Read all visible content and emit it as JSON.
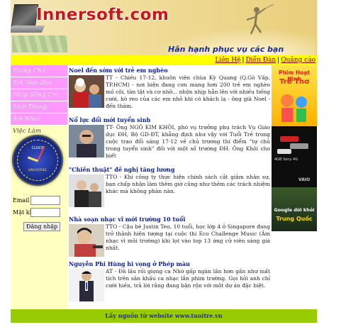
{
  "banner": {
    "logo": "Innersoft.com",
    "slogan": "Hân hạnh phục vụ các bạn"
  },
  "toplinks": [
    "Liên Hệ",
    "Diễn Đàn",
    "Quảng cáo"
  ],
  "sidebar": {
    "menu": [
      "Trang Chủ",
      "Tin Giáo Dục",
      "Nhịp Sống Trẻ",
      "Thời Trang",
      "Âm Nhạc",
      "Việc Làm"
    ],
    "clock_top": "CLOCK",
    "clock_bottom": "UNIVERSE"
  },
  "login": {
    "email_label": "Email",
    "password_label": "Mật khẩu",
    "submit_label": "Đăng nhập"
  },
  "articles": [
    {
      "title": "Noel đến sớm với trẻ em nghèo",
      "body": "TT - Chiều 17-12, khuôn viên chùa Kỳ Quang (Q.Gò Vấp, TP.HCM) - nơi hiện đang cưu mang hơn 200 trẻ em nghèo mồ côi, tàn tật và cơ nhỡ... nhộn nhịp hẳn lên với nhiều tiếng cười, hò reo của các em nhỏ khi có khách lạ - ông già Noel - đến thăm."
    },
    {
      "title": "Nổ lực đổi mới tuyển sinh",
      "body": "TT- Ông NGÔ KIM KHÔI, phó vụ trưởng phụ trách Vụ Giáo dục ĐH, Bộ GD-ĐT, khẳng định như vậy với Tuổi Trẻ trong cuộc trao đổi sáng 17-12 về chủ trương thí điểm \"tự chủ trong tuyển sinh\" đối với một số trường ĐH. Ông Khôi cho biết"
    },
    {
      "title": "\"Chiến thuật\" đề nghị tăng lương",
      "body": "TTO - Khi công ty thực hiện chính sách cắt giảm nhân sự, bạn chấp nhận làm thêm giờ cũng như thêm các trách nhiệm khác mà không phàn nàn."
    },
    {
      "title": "Nhà soạn nhạc vĩ mới trường 10 tuổi",
      "body": "TTO - Cậu bé Justin Teo, 10 tuổi, học lớp 4 ở Singapore đang trở thành hiện tượng tại cuộc thi Eco Challenge Music (Âm nhạc vì môi trường) khi lọt vào top 13 ứng cử viên sáng giá nhất."
    },
    {
      "title": "Nguyễn Phi Hùng hi vọng ở Phép màu",
      "body": "AT - Đã lâu rồi giọng ca Nhớ gấp ngàn lần hơn gần như mất tích trên sân khấu ca nhạc lẫn phim trường. Gọi hỏi anh chỉ cười hiền, trả lời rằng đang bận rộn với một dự án đặc biệt."
    }
  ],
  "ads": {
    "ad1_line1": "Phim Hoạt Hình",
    "ad1_line2": "Trẻ Thơ",
    "ad2_text": "4GB Sony 4G",
    "ad2_brand": "VAIO",
    "ad3_line1": "Google dời khỏi",
    "ad3_line2": "Trung Quốc"
  },
  "footer": {
    "text": "Lấy nguồn từ website www.tuoitre.vn"
  },
  "colors": {
    "menu_pink": "#ff99ff",
    "topbar_yellow": "#ffff00",
    "sidebar_bg": "#ffffbf",
    "footer_green": "#99cc00",
    "title_blue": "#0a1f8f",
    "logo_red": "#c81818"
  }
}
